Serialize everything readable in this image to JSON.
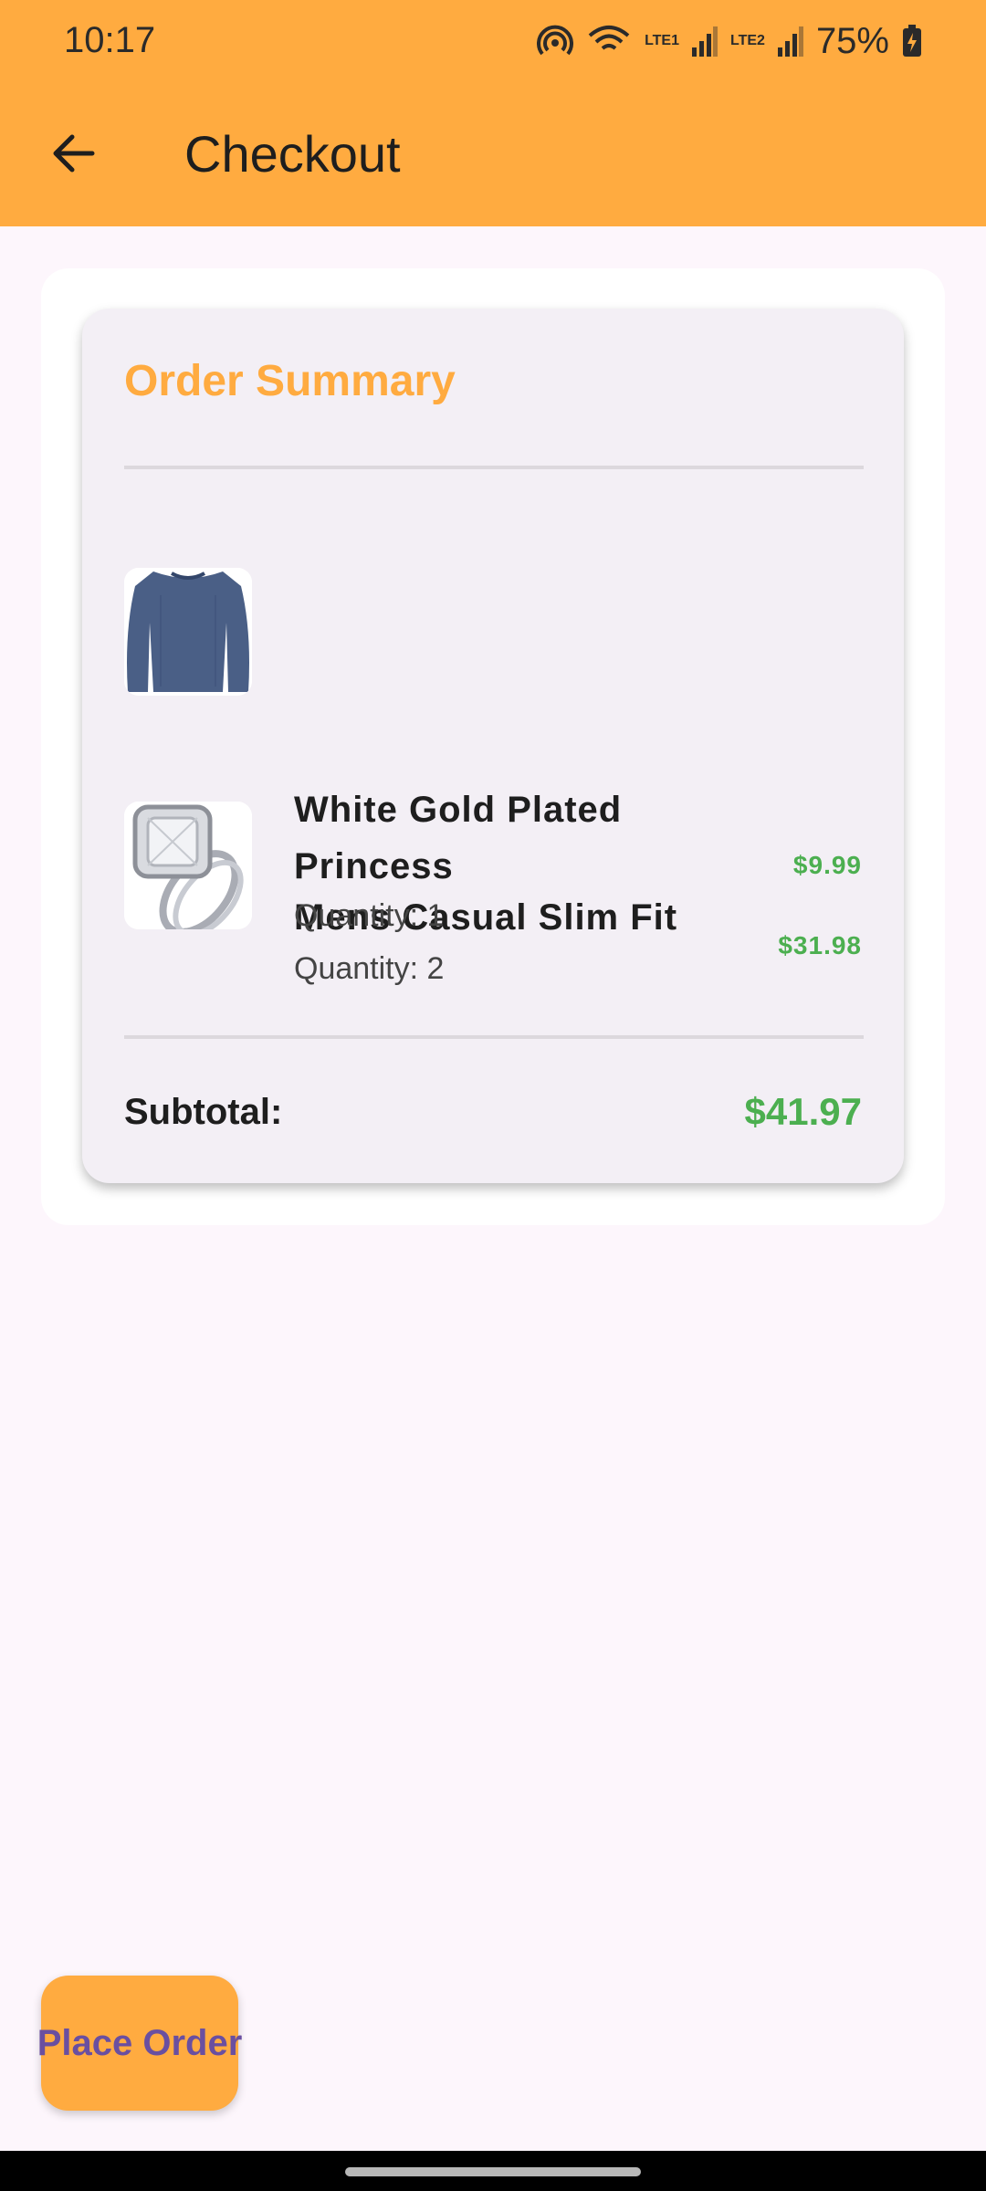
{
  "status_bar": {
    "time": "10:17",
    "battery": "75%",
    "sim1": "LTE1",
    "sim2": "LTE2"
  },
  "app_bar": {
    "title": "Checkout",
    "back_icon": "arrow-back-icon"
  },
  "order_summary": {
    "title": "Order Summary",
    "items": [
      {
        "name": "Mens Casual Slim Fit",
        "quantity": "Quantity: 2",
        "price": "$31.98",
        "image": "blue-shirt"
      },
      {
        "name": "White Gold Plated Princess",
        "quantity": "Quantity: 1",
        "price": "$9.99",
        "image": "diamond-ring"
      }
    ],
    "subtotal_label": "Subtotal:",
    "subtotal_value": "$41.97"
  },
  "actions": {
    "place_order_label": "Place Order"
  },
  "colors": {
    "primary": "#ffab40",
    "price": "#4caf50",
    "button_text": "#6a4fa0",
    "background": "#fdf6fc"
  }
}
